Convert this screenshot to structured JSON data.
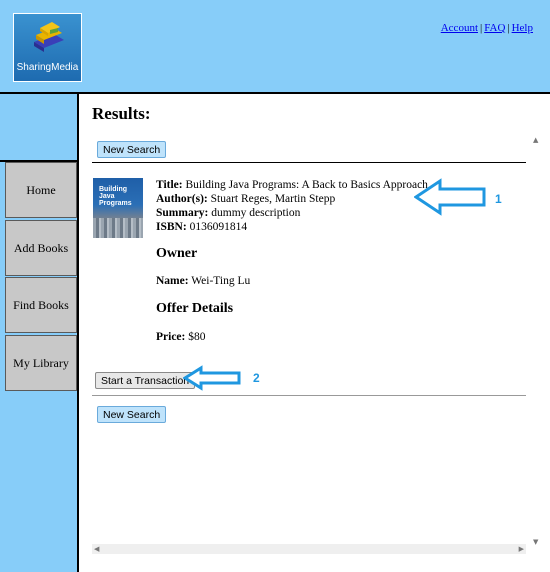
{
  "header": {
    "logo_text": "SharingMedia",
    "links": [
      "Account",
      "FAQ",
      "Help"
    ],
    "link_separator": "|"
  },
  "sidebar": {
    "items": [
      {
        "label": "Home"
      },
      {
        "label": "Add Books"
      },
      {
        "label": "Find Books"
      },
      {
        "label": "My Library"
      }
    ]
  },
  "main": {
    "title": "Results:",
    "new_search_label": "New Search",
    "book": {
      "title_label": "Title:",
      "title": "Building Java Programs: A Back to Basics Approach",
      "authors_label": "Author(s):",
      "authors": "Stuart Reges, Martin Stepp",
      "summary_label": "Summary:",
      "summary": "dummy description",
      "isbn_label": "ISBN:",
      "isbn": "0136091814",
      "cover_text": "Building Java Programs"
    },
    "owner": {
      "heading": "Owner",
      "name_label": "Name:",
      "name": "Wei-Ting Lu"
    },
    "offer": {
      "heading": "Offer Details",
      "price_label": "Price:",
      "price": "$80"
    },
    "transaction_label": "Start a Transaction"
  },
  "annotations": {
    "arrow1_number": "1",
    "arrow2_number": "2",
    "color": "#1f97e0"
  },
  "colors": {
    "header_bg": "#87cdf9",
    "sidebar_bg": "#87cdf9",
    "nav_bg": "#c8c8c8",
    "button_blue": "#bfe3fb"
  }
}
